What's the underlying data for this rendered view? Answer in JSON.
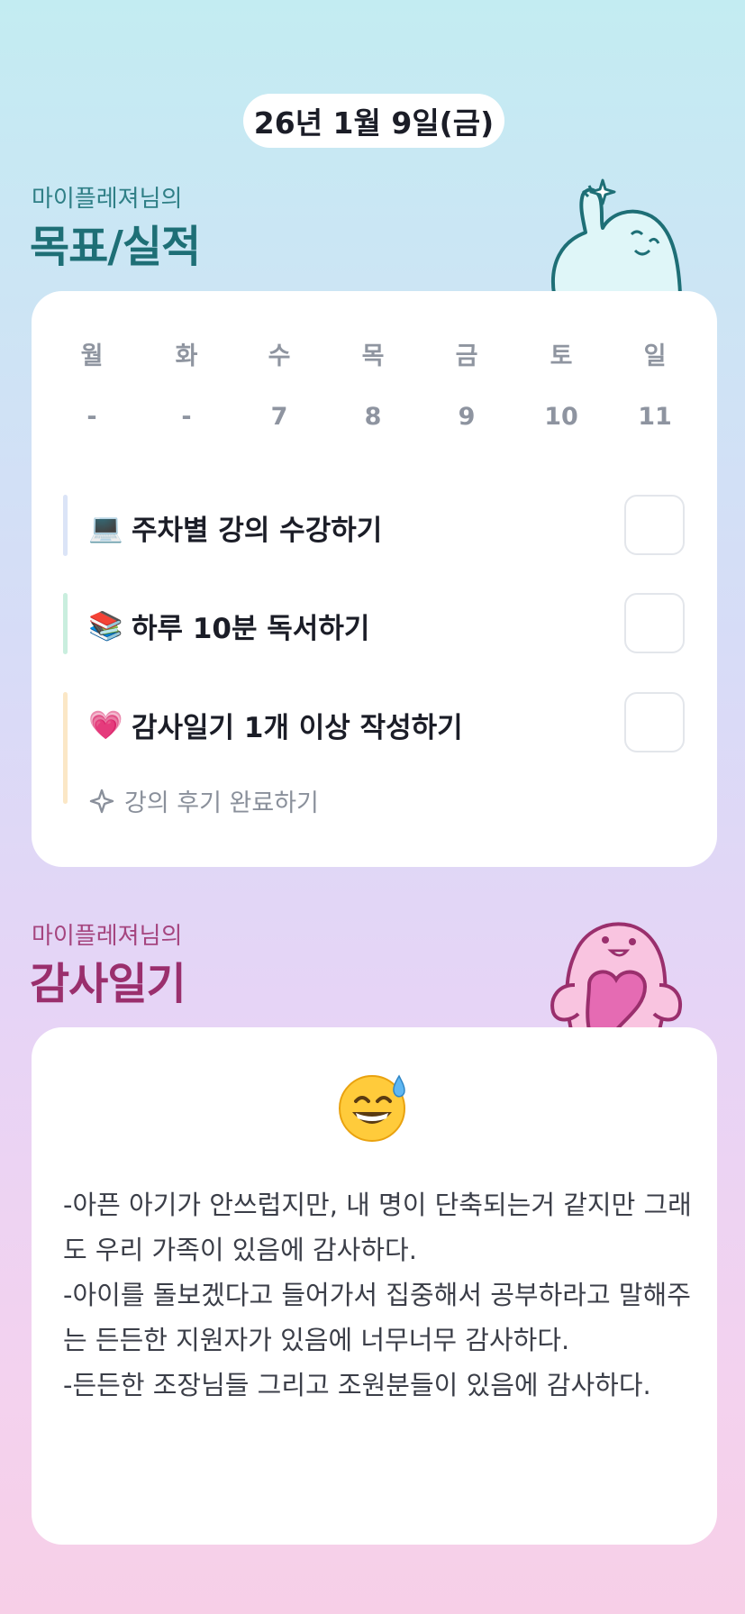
{
  "header": {
    "date": "26년 1월 9일(금)"
  },
  "goals_section": {
    "subtitle": "마이플레져님의",
    "title": "목표/실적",
    "weekdays": [
      "월",
      "화",
      "수",
      "목",
      "금",
      "토",
      "일"
    ],
    "day_numbers": [
      "-",
      "-",
      "7",
      "8",
      "9",
      "10",
      "11"
    ],
    "goals": [
      {
        "emoji": "💻",
        "label": "주차별 강의 수강하기",
        "bar_color": "#dbe4f7",
        "checked": false
      },
      {
        "emoji": "📚",
        "label": "하루 10분 독서하기",
        "bar_color": "#c9eede",
        "checked": false
      },
      {
        "emoji": "💗",
        "label": "감사일기 1개 이상 작성하기",
        "bar_color": "#fbe7c6",
        "checked": false
      }
    ],
    "sub_task": {
      "icon": "sparkle-outline-icon",
      "label": "강의 후기 완료하기"
    }
  },
  "thanks_section": {
    "subtitle": "마이플레져님의",
    "title": "감사일기",
    "mood_emoji": "😅",
    "entries": [
      "-아픈 아기가 안쓰럽지만, 내 명이 단축되는거 같지만 그래도 우리 가족이 있음에 감사하다.",
      "-아이를 돌보겠다고 들어가서 집중해서 공부하라고 말해주는 든든한 지원자가 있음에 너무너무 감사하다.",
      "-든든한 조장님들 그리고 조원분들이 있음에 감사하다."
    ]
  },
  "colors": {
    "goal_title": "#1e6f76",
    "thanks_title": "#9a2f6d",
    "mascot_blue": "#d9f5f7",
    "mascot_pink": "#f7b9dc"
  }
}
